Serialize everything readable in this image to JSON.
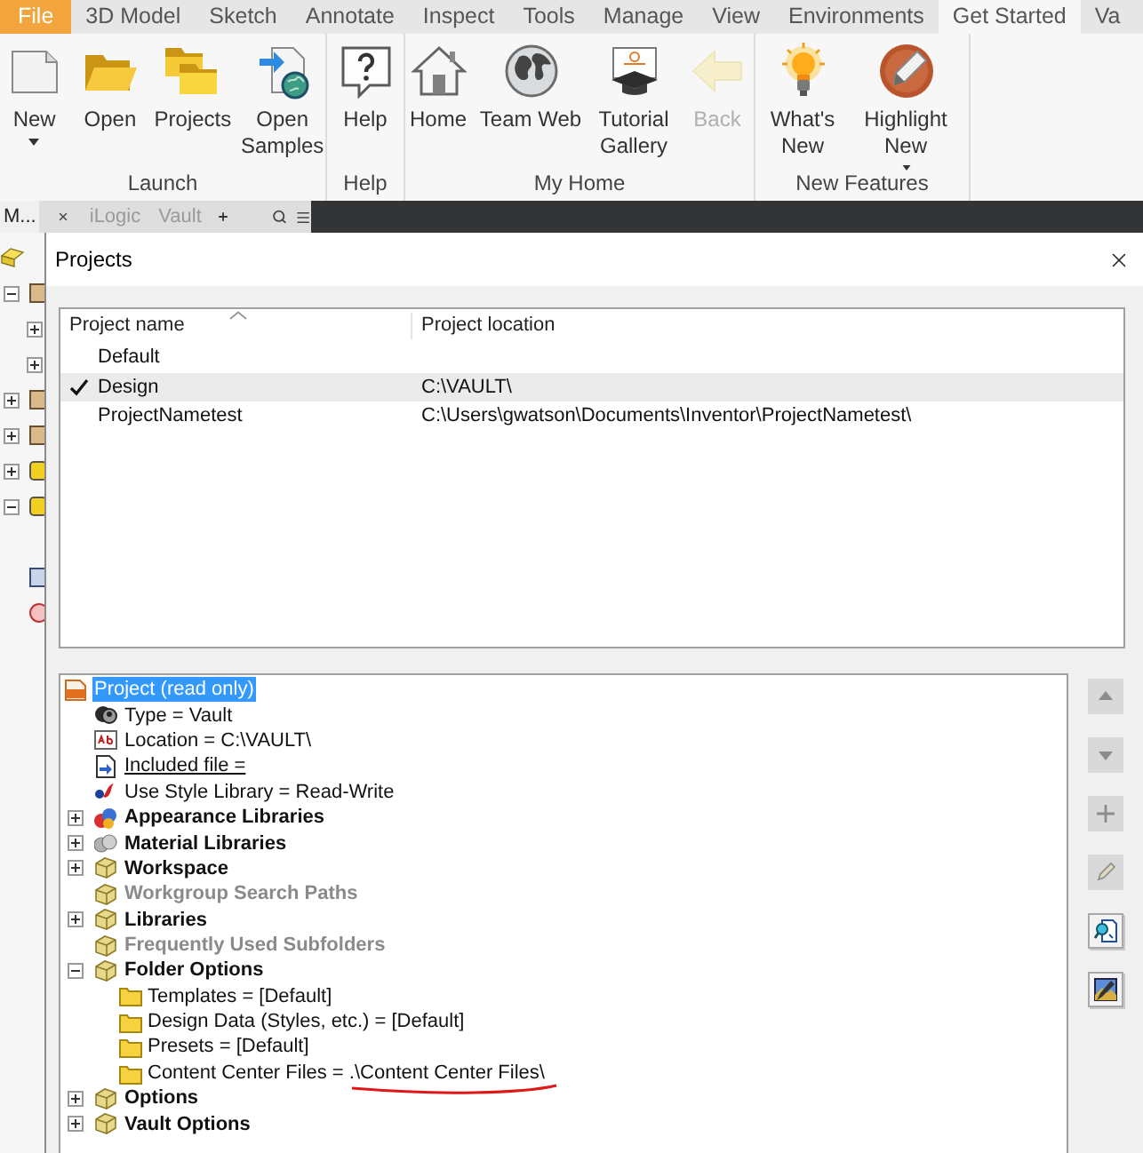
{
  "ribbon_tabs": [
    {
      "label": "File",
      "kind": "app",
      "selected": false
    },
    {
      "label": "3D Model",
      "kind": "tab",
      "selected": false
    },
    {
      "label": "Sketch",
      "kind": "tab",
      "selected": false
    },
    {
      "label": "Annotate",
      "kind": "tab",
      "selected": false
    },
    {
      "label": "Inspect",
      "kind": "tab",
      "selected": false
    },
    {
      "label": "Tools",
      "kind": "tab",
      "selected": false
    },
    {
      "label": "Manage",
      "kind": "tab",
      "selected": false
    },
    {
      "label": "View",
      "kind": "tab",
      "selected": false
    },
    {
      "label": "Environments",
      "kind": "tab",
      "selected": false
    },
    {
      "label": "Get Started",
      "kind": "tab",
      "selected": true
    },
    {
      "label": "Va",
      "kind": "tab",
      "selected": false
    }
  ],
  "ribbon_groups": [
    {
      "label": "Launch",
      "buttons": [
        {
          "label": "New",
          "dropdown": true,
          "disabled": false
        },
        {
          "label": "Open",
          "dropdown": false,
          "disabled": false
        },
        {
          "label": "Projects",
          "dropdown": false,
          "disabled": false
        },
        {
          "label": "Open Samples",
          "dropdown": false,
          "disabled": false
        }
      ]
    },
    {
      "label": "Help",
      "buttons": [
        {
          "label": "Help",
          "dropdown": false,
          "disabled": false
        }
      ]
    },
    {
      "label": "My Home",
      "buttons": [
        {
          "label": "Home",
          "dropdown": false,
          "disabled": false
        },
        {
          "label": "Team Web",
          "dropdown": false,
          "disabled": false
        },
        {
          "label": "Tutorial Gallery",
          "dropdown": false,
          "disabled": false
        },
        {
          "label": "Back",
          "dropdown": false,
          "disabled": true
        }
      ]
    },
    {
      "label": "New Features",
      "buttons": [
        {
          "label": "What's New",
          "dropdown": false,
          "disabled": false
        },
        {
          "label": "Highlight New",
          "dropdown": true,
          "disabled": false
        }
      ]
    }
  ],
  "browser_bar": {
    "tabs": [
      {
        "label": "M...",
        "selected": true
      },
      {
        "label": "iLogic",
        "selected": false
      },
      {
        "label": "Vault",
        "selected": false
      }
    ]
  },
  "model_browser": {
    "nodes": [
      {
        "kind": "root"
      },
      {
        "kind": "part",
        "expanded": true
      },
      {
        "kind": "sub",
        "expanded": false
      },
      {
        "kind": "sub",
        "expanded": false
      },
      {
        "kind": "part",
        "expanded": false
      },
      {
        "kind": "part",
        "expanded": false
      },
      {
        "kind": "folder",
        "expanded": false
      },
      {
        "kind": "folder",
        "expanded": true
      },
      {
        "kind": "view"
      },
      {
        "kind": "marker"
      }
    ]
  },
  "dialog": {
    "title": "Projects",
    "project_list": {
      "columns": [
        "Project name",
        "Project location"
      ],
      "rows": [
        {
          "name": "Default",
          "active": false,
          "selected": false
        },
        {
          "name": "Design",
          "location": "C:\\VAULT\\",
          "active": true,
          "selected": true
        },
        {
          "name": "ProjectNametest",
          "location": "C:\\Users\\gwatson\\Documents\\Inventor\\ProjectNametest\\",
          "active": false,
          "selected": false
        }
      ]
    },
    "settings_tree": [
      {
        "label": "Project (read only)",
        "kind": "project",
        "selected": true,
        "children": [
          {
            "label": "Type = Vault",
            "kind": "property",
            "selected": false,
            "disabled": false
          },
          {
            "label": "Location = C:\\VAULT\\",
            "kind": "property",
            "selected": false,
            "disabled": false
          },
          {
            "label": "Included file =",
            "kind": "link",
            "selected": false,
            "disabled": false
          },
          {
            "label": "Use Style Library = Read-Write",
            "kind": "property",
            "selected": false,
            "disabled": false
          },
          {
            "label": "Appearance Libraries",
            "kind": "group",
            "selected": false,
            "disabled": false,
            "expanded": false
          },
          {
            "label": "Material Libraries",
            "kind": "group",
            "selected": false,
            "disabled": false,
            "expanded": false
          },
          {
            "label": "Workspace",
            "kind": "group",
            "selected": false,
            "disabled": false,
            "expanded": false
          },
          {
            "label": "Workgroup Search Paths",
            "kind": "group",
            "selected": false,
            "disabled": true
          },
          {
            "label": "Libraries",
            "kind": "group",
            "selected": false,
            "disabled": false,
            "expanded": false
          },
          {
            "label": "Frequently Used Subfolders",
            "kind": "group",
            "selected": false,
            "disabled": true
          },
          {
            "label": "Folder Options",
            "kind": "group",
            "selected": false,
            "disabled": false,
            "expanded": true,
            "children": [
              {
                "label": "Templates = [Default]",
                "kind": "folder",
                "selected": false,
                "annotated": false
              },
              {
                "label": "Design Data (Styles, etc.) = [Default]",
                "kind": "folder",
                "selected": false,
                "annotated": false
              },
              {
                "label": "Presets = [Default]",
                "kind": "folder",
                "selected": false,
                "annotated": false
              },
              {
                "label": "Content Center Files = .\\Content Center Files\\",
                "kind": "folder",
                "selected": false,
                "annotated": true
              }
            ]
          },
          {
            "label": "Options",
            "kind": "group",
            "selected": false,
            "disabled": false,
            "expanded": false
          },
          {
            "label": "Vault Options",
            "kind": "group",
            "selected": false,
            "disabled": false,
            "expanded": false
          }
        ]
      }
    ],
    "side_buttons": [
      {
        "disabled": true
      },
      {
        "disabled": true
      },
      {
        "disabled": true
      },
      {
        "disabled": true
      },
      {
        "disabled": false
      },
      {
        "disabled": false
      }
    ]
  }
}
